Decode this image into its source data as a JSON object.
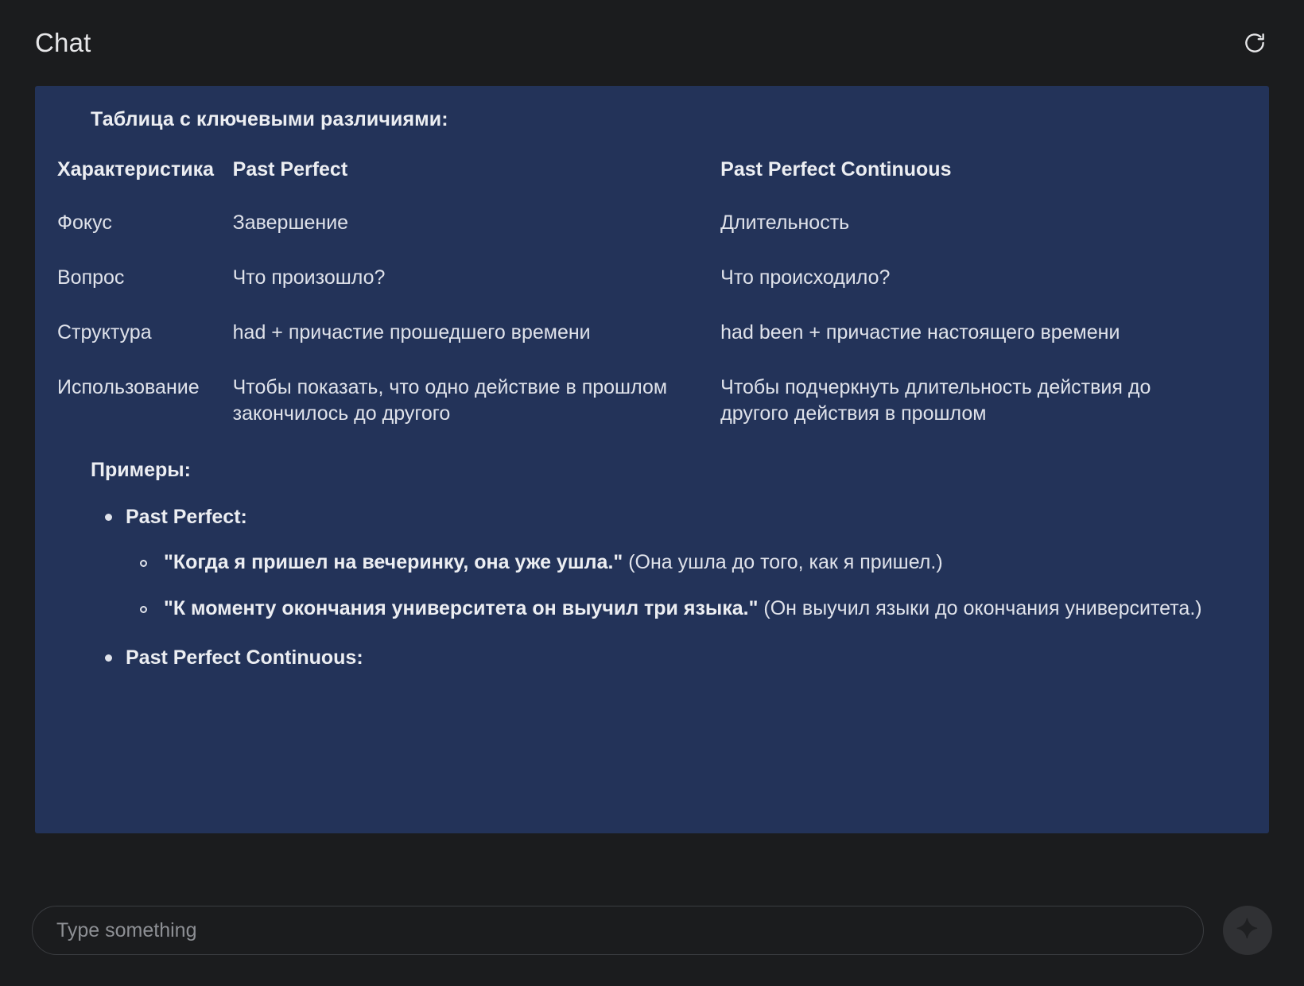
{
  "header": {
    "title": "Chat",
    "refresh_icon": "refresh-icon"
  },
  "message": {
    "table_title": "Таблица с ключевыми различиями:",
    "table": {
      "columns": [
        "Характеристика",
        "Past Perfect",
        "Past Perfect Continuous"
      ],
      "rows": [
        {
          "characteristic": "Фокус",
          "past_perfect": "Завершение",
          "past_perfect_continuous": "Длительность"
        },
        {
          "characteristic": "Вопрос",
          "past_perfect": "Что произошло?",
          "past_perfect_continuous": "Что происходило?"
        },
        {
          "characteristic": "Структура",
          "past_perfect": "had + причастие прошедшего времени",
          "past_perfect_continuous": "had been + причастие настоящего времени"
        },
        {
          "characteristic": "Использование",
          "past_perfect": "Чтобы показать, что одно действие в прошлом закончилось до другого",
          "past_perfect_continuous": "Чтобы подчеркнуть длительность действия до другого действия в прошлом"
        }
      ]
    },
    "examples_title": "Примеры:",
    "examples": [
      {
        "label": "Past Perfect:",
        "items": [
          {
            "quote": "\"Когда я пришел на вечеринку, она уже ушла.\"",
            "gloss": "(Она ушла до того, как я пришел.)"
          },
          {
            "quote": "\"К моменту окончания университета он выучил три языка.\"",
            "gloss": "(Он выучил языки до окончания университета.)"
          }
        ]
      },
      {
        "label": "Past Perfect Continuous:",
        "items": []
      }
    ]
  },
  "composer": {
    "placeholder": "Type something",
    "value": "",
    "send_icon": "sparkle-icon"
  },
  "colors": {
    "page_background": "#1b1c1e",
    "bubble_background": "#233359",
    "text_primary": "#eceef2",
    "text_secondary": "#dfe2ea",
    "placeholder": "#8d8f94",
    "send_button": "#303134"
  }
}
